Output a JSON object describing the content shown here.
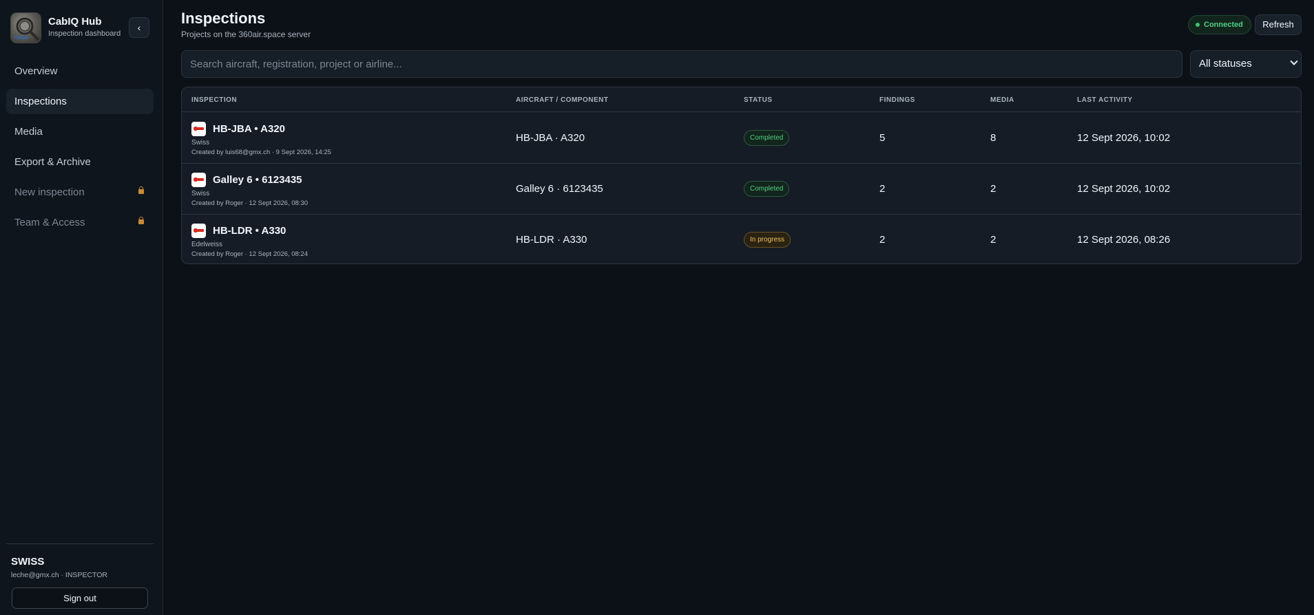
{
  "brand": {
    "title": "CabIQ Hub",
    "subtitle": "Inspection dashboard",
    "logo_text": "TEAMS",
    "collapse_icon": "‹"
  },
  "nav": {
    "items": [
      {
        "label": "Overview",
        "active": false,
        "locked": false
      },
      {
        "label": "Inspections",
        "active": true,
        "locked": false
      },
      {
        "label": "Media",
        "active": false,
        "locked": false
      },
      {
        "label": "Export & Archive",
        "active": false,
        "locked": false
      },
      {
        "label": "New inspection",
        "active": false,
        "locked": true
      },
      {
        "label": "Team & Access",
        "active": false,
        "locked": true
      }
    ]
  },
  "user": {
    "org": "SWISS",
    "meta": "leche@gmx.ch · INSPECTOR",
    "signout_label": "Sign out"
  },
  "header": {
    "title": "Inspections",
    "subtitle": "Projects on the 360air.space server",
    "connection_label": "Connected",
    "refresh_label": "Refresh"
  },
  "filters": {
    "search_placeholder": "Search aircraft, registration, project or airline...",
    "status_selected": "All statuses"
  },
  "table": {
    "columns": [
      "INSPECTION",
      "AIRCRAFT / COMPONENT",
      "STATUS",
      "FINDINGS",
      "MEDIA",
      "LAST ACTIVITY"
    ],
    "rows": [
      {
        "title": "HB-JBA • A320",
        "airline": "Swiss",
        "created": "Created by luis68@gmx.ch · 9 Sept 2026, 14:25",
        "aircraft": "HB-JBA · A320",
        "status": "Completed",
        "findings": "5",
        "media": "8",
        "last_activity": "12 Sept 2026, 10:02"
      },
      {
        "title": "Galley 6 • 6123435",
        "airline": "Swiss",
        "created": "Created by Roger · 12 Sept 2026, 08:30",
        "aircraft": "Galley 6 · 6123435",
        "status": "Completed",
        "findings": "2",
        "media": "2",
        "last_activity": "12 Sept 2026, 10:02"
      },
      {
        "title": "HB-LDR • A330",
        "airline": "Edelweiss",
        "created": "Created by Roger · 12 Sept 2026, 08:24",
        "aircraft": "HB-LDR · A330",
        "status": "In progress",
        "findings": "2",
        "media": "2",
        "last_activity": "12 Sept 2026, 08:26"
      }
    ]
  },
  "colors": {
    "background": "#0c1117",
    "sidebar": "#0f151c",
    "completed": "#4fcf85",
    "in_progress": "#f0c15a",
    "lock": "#c88a3a"
  }
}
